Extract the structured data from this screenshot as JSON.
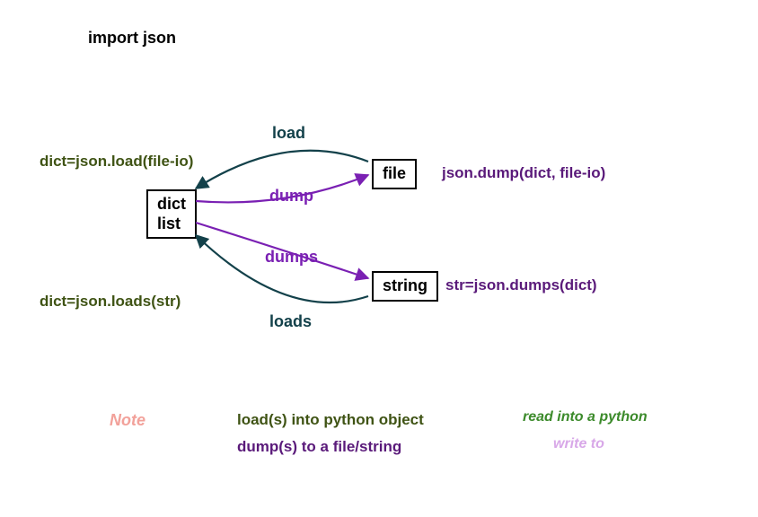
{
  "header": {
    "import_stmt": "import json"
  },
  "boxes": {
    "dictlist": "dict\nlist",
    "file": "file",
    "string": "string"
  },
  "arrow_labels": {
    "load": "load",
    "dump": "dump",
    "dumps": "dumps",
    "loads": "loads"
  },
  "sides": {
    "load_left": "dict=json.load(file-io)",
    "loads_left": "dict=json.loads(str)",
    "dump_right": "json.dump(dict, file-io)",
    "dumps_right": "str=json.dumps(dict)"
  },
  "notes": {
    "note_label": "Note",
    "load_note": "load(s) into python object",
    "dump_note": "dump(s) to a file/string",
    "read_note": "read into a python",
    "write_note": "write to"
  },
  "colors": {
    "olive": "#3f5314",
    "teal": "#13414a",
    "purple": "#7a20b3",
    "darkpurple": "#5a1a7a",
    "salmon": "#f2a19a",
    "green": "#3b8a2a",
    "lightpurple": "#d8a8e8",
    "black": "#000000"
  }
}
